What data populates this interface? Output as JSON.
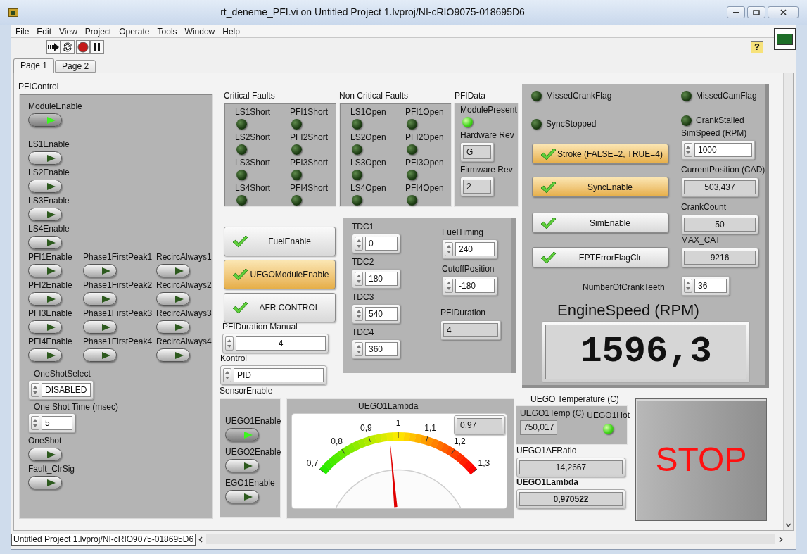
{
  "window": {
    "title": "rt_deneme_PFI.vi on Untitled Project 1.lvproj/NI-cRIO9075-018695D6"
  },
  "menu_bar": [
    "File",
    "Edit",
    "View",
    "Project",
    "Operate",
    "Tools",
    "Window",
    "Help"
  ],
  "help_button": "?",
  "tabs": [
    {
      "label": "Page 1",
      "selected": true
    },
    {
      "label": "Page 2",
      "selected": false
    }
  ],
  "pfi_control": {
    "title": "PFIControl",
    "top_switches": [
      {
        "label": "ModuleEnable",
        "on": true
      },
      {
        "label": "LS1Enable",
        "on": false
      },
      {
        "label": "LS2Enable",
        "on": false
      },
      {
        "label": "LS3Enable",
        "on": false
      },
      {
        "label": "LS4Enable",
        "on": false
      }
    ],
    "switch_grid": [
      {
        "label": "PFI1Enable",
        "on": false
      },
      {
        "label": "Phase1FirstPeak1",
        "on": false
      },
      {
        "label": "RecircAlways1",
        "on": false
      },
      {
        "label": "PFI2Enable",
        "on": false
      },
      {
        "label": "Phase1FirstPeak2",
        "on": false
      },
      {
        "label": "RecircAlways2",
        "on": false
      },
      {
        "label": "PFI3Enable",
        "on": false
      },
      {
        "label": "Phase1FirstPeak3",
        "on": false
      },
      {
        "label": "RecircAlways3",
        "on": false
      },
      {
        "label": "PFI4Enable",
        "on": false
      },
      {
        "label": "Phase1FirstPeak4",
        "on": false
      },
      {
        "label": "RecircAlways4",
        "on": false
      }
    ],
    "one_shot_select": {
      "label": "OneShotSelect",
      "value": "DISABLED"
    },
    "one_shot_time": {
      "label": "One Shot Time (msec)",
      "value": "5"
    },
    "bottom_switches": [
      {
        "label": "OneShot",
        "on": false
      },
      {
        "label": "Fault_ClrSig",
        "on": false
      }
    ]
  },
  "critical_faults": {
    "title": "Critical Faults",
    "leds": [
      {
        "label": "LS1Short",
        "on": false
      },
      {
        "label": "PFI1Short",
        "on": false
      },
      {
        "label": "LS2Short",
        "on": false
      },
      {
        "label": "PFI2Short",
        "on": false
      },
      {
        "label": "LS3Short",
        "on": false
      },
      {
        "label": "PFI3Short",
        "on": false
      },
      {
        "label": "LS4Short",
        "on": false
      },
      {
        "label": "PFI4Short",
        "on": false
      }
    ]
  },
  "non_critical_faults": {
    "title": "Non Critical Faults",
    "leds": [
      {
        "label": "LS1Open",
        "on": false
      },
      {
        "label": "PFI1Open",
        "on": false
      },
      {
        "label": "LS2Open",
        "on": false
      },
      {
        "label": "PFI2Open",
        "on": false
      },
      {
        "label": "LS3Open",
        "on": false
      },
      {
        "label": "PFI3Open",
        "on": false
      },
      {
        "label": "LS4Open",
        "on": false
      },
      {
        "label": "PFI4Open",
        "on": false
      }
    ]
  },
  "pfi_data": {
    "title": "PFIData",
    "module_present": {
      "label": "ModulePresent",
      "on": true
    },
    "hardware_rev": {
      "label": "Hardware Rev",
      "value": "G"
    },
    "firmware_rev": {
      "label": "Firmware Rev",
      "value": "2"
    }
  },
  "fuel_buttons": [
    {
      "label": "FuelEnable",
      "on": false
    },
    {
      "label": "UEGOModuleEnable",
      "on": true
    },
    {
      "label": "AFR CONTROL",
      "on": false
    }
  ],
  "pfi_duration_manual": {
    "label": "PFIDuration Manual",
    "value": "4"
  },
  "kontrol": {
    "label": "Kontrol",
    "value": "PID"
  },
  "timing": {
    "tdc": [
      {
        "label": "TDC1",
        "value": "0"
      },
      {
        "label": "TDC2",
        "value": "180"
      },
      {
        "label": "TDC3",
        "value": "540"
      },
      {
        "label": "TDC4",
        "value": "360"
      }
    ],
    "fuel_timing": {
      "label": "FuelTiming",
      "value": "240"
    },
    "cutoff_position": {
      "label": "CutoffPosition",
      "value": "-180"
    },
    "pfi_duration": {
      "label": "PFIDuration",
      "value": "4"
    }
  },
  "engine": {
    "flags": [
      {
        "label": "MissedCrankFlag",
        "on": false
      },
      {
        "label": "MissedCamFlag",
        "on": false
      },
      {
        "label": "SyncStopped",
        "on": false
      },
      {
        "label": "CrankStalled",
        "on": false
      }
    ],
    "buttons": [
      {
        "label": "Stroke (FALSE=2, TRUE=4)",
        "on": true
      },
      {
        "label": "SyncEnable",
        "on": true
      },
      {
        "label": "SimEnable",
        "on": false
      },
      {
        "label": "EPTErrorFlagClr",
        "on": false
      }
    ],
    "sim_speed": {
      "label": "SimSpeed (RPM)",
      "value": "1000"
    },
    "current_position": {
      "label": "CurrentPosition (CAD)",
      "value": "503,437"
    },
    "crank_count": {
      "label": "CrankCount",
      "value": "50"
    },
    "max_cat": {
      "label": "MAX_CAT",
      "value": "9216"
    },
    "crank_teeth": {
      "label": "NumberOfCrankTeeth",
      "value": "36"
    },
    "engine_speed": {
      "label": "EngineSpeed (RPM)",
      "value": "1596,3"
    }
  },
  "sensor_enable": {
    "title": "SensorEnable",
    "switches": [
      {
        "label": "UEGO1Enable",
        "on": true
      },
      {
        "label": "UEGO2Enable",
        "on": false
      },
      {
        "label": "EGO1Enable",
        "on": false
      }
    ]
  },
  "lambda_gauge": {
    "title": "UEGO1Lambda",
    "readout": "0,97",
    "scale_labels": [
      "0,7",
      "0,8",
      "0,9",
      "1",
      "1,1",
      "1,2",
      "1,3"
    ],
    "level": 0.45
  },
  "uego_temperature": {
    "title": "UEGO Temperature (C)",
    "temp": {
      "label": "UEGO1Temp (C)",
      "value": "750,017"
    },
    "hot": {
      "label": "UEGO1Hot",
      "on": true
    }
  },
  "afr_ratio": {
    "label": "UEGO1AFRatio",
    "value": "14,2667"
  },
  "lambda": {
    "label": "UEGO1Lambda",
    "value": "0,970522"
  },
  "stop_button": {
    "label": "STOP"
  },
  "status_bar": {
    "path": "Untitled Project 1.lvproj/NI-cRIO9075-018695D6"
  }
}
